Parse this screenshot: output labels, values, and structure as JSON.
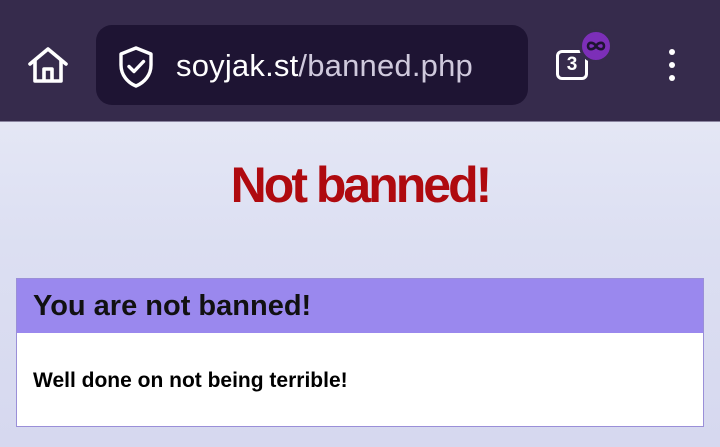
{
  "browser": {
    "url": {
      "domain": "soyjak.st",
      "path": "/banned.php"
    },
    "tab_count": "3",
    "icons": {
      "home": "home-icon",
      "security": "shield-check-icon",
      "tabs": "tab-switcher-icon",
      "private": "infinity-icon",
      "menu": "more-vert-icon"
    },
    "colors": {
      "toolbar": "#362b4c",
      "url_bar": "#1e1433",
      "private_badge": "#7c2fb8"
    }
  },
  "page": {
    "title": "Not banned!",
    "box": {
      "heading": "You are not banned!",
      "message": "Well done on not being terrible!"
    },
    "colors": {
      "title": "#af0a0f",
      "box_header": "#9a88ee",
      "box_border": "#9a8fd8"
    }
  }
}
